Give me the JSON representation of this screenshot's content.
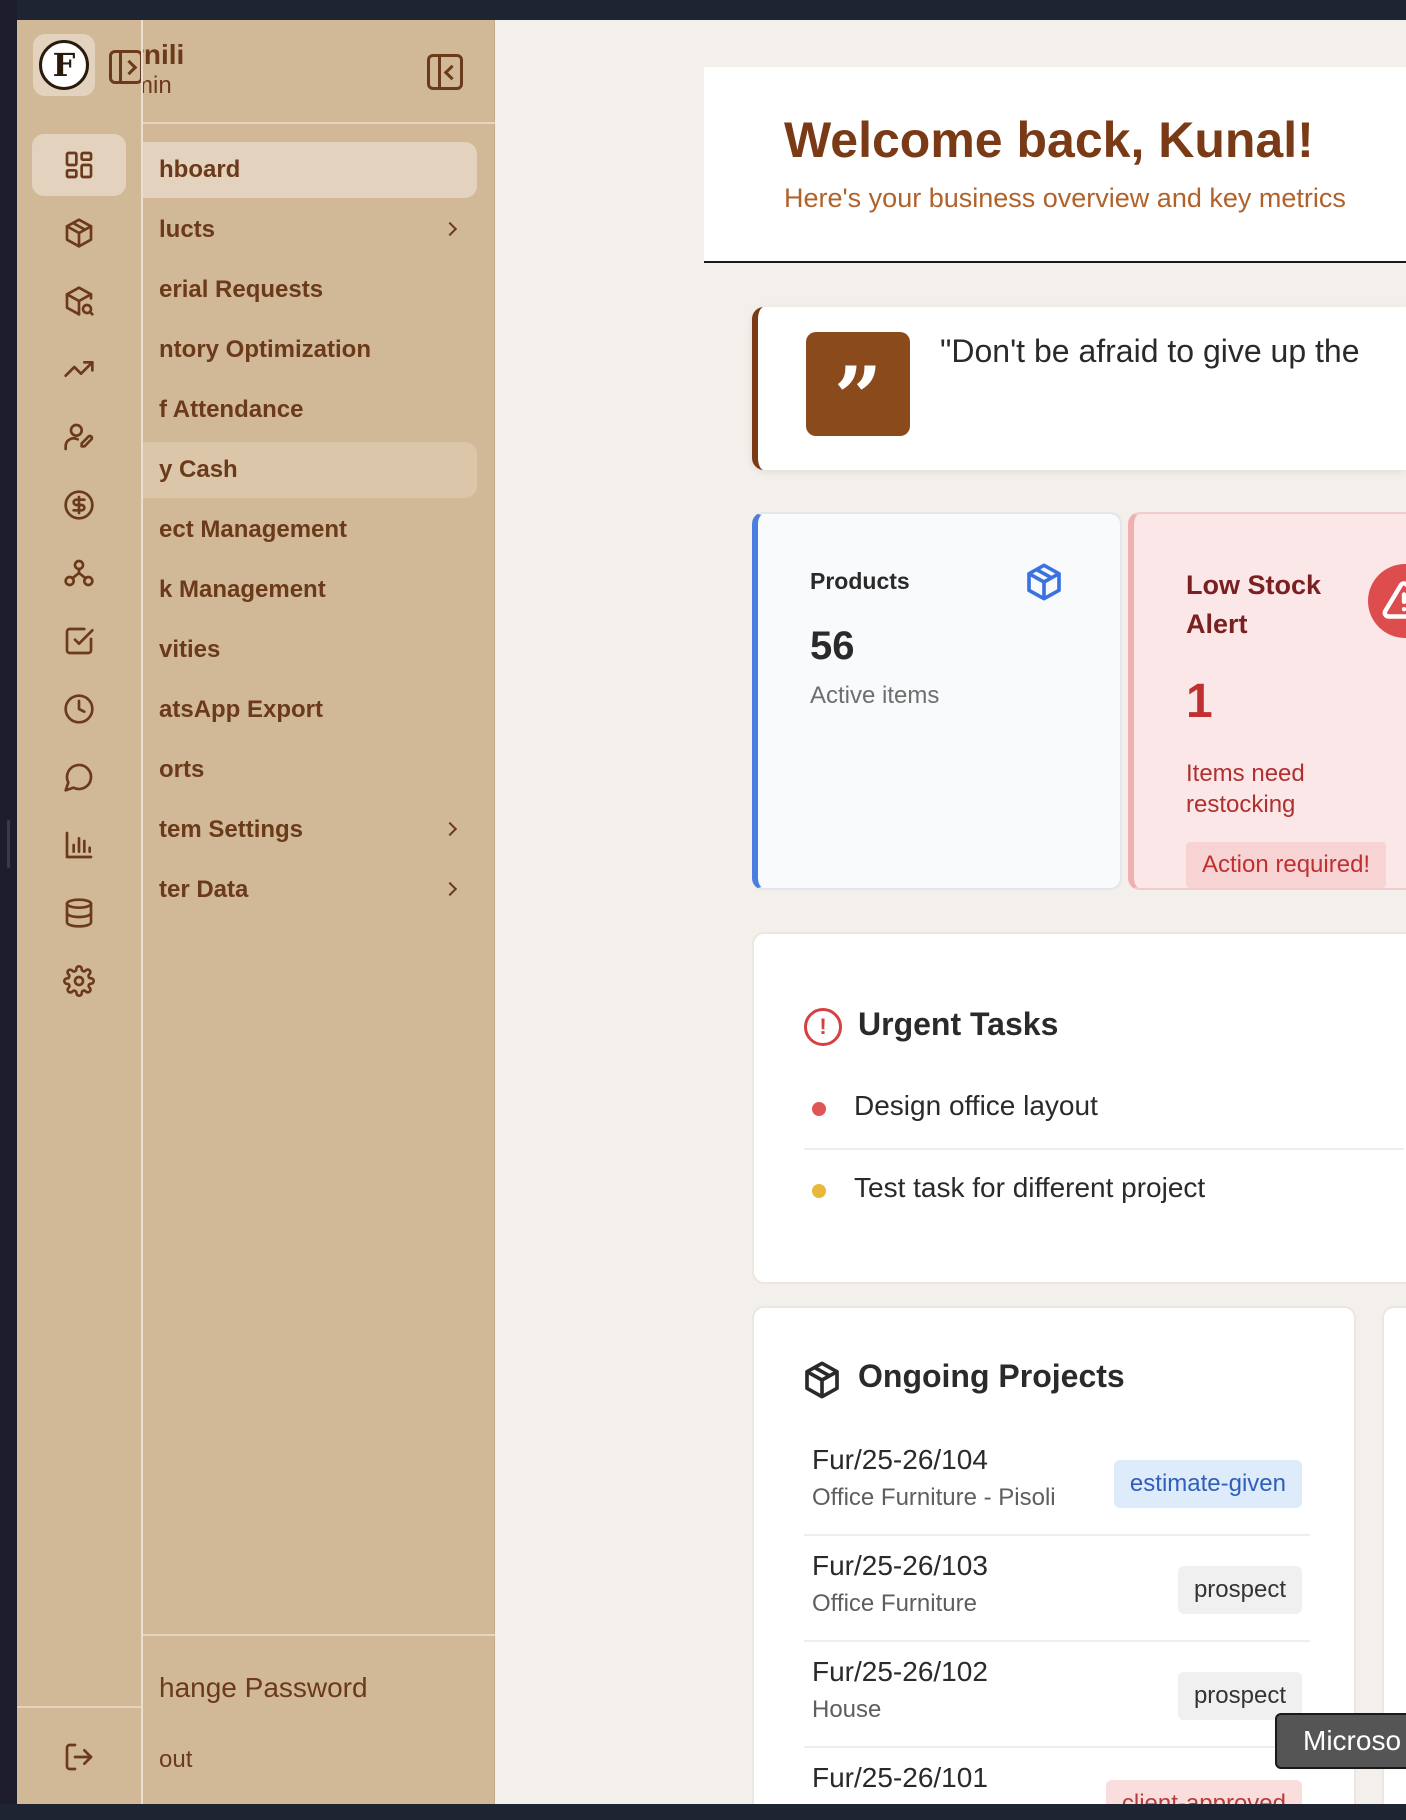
{
  "sidebar": {
    "brand_name": "rnili",
    "brand_role": "min",
    "logo_letter": "F",
    "items": [
      {
        "label": "hboard",
        "icon": "dashboard-icon",
        "active": true
      },
      {
        "label": "lucts",
        "icon": "package-icon",
        "has_submenu": true
      },
      {
        "label": "erial Requests",
        "icon": "package-search-icon"
      },
      {
        "label": "ntory Optimization",
        "icon": "trending-up-icon"
      },
      {
        "label": "f Attendance",
        "icon": "user-pen-icon"
      },
      {
        "label": "y Cash",
        "icon": "dollar-circle-icon",
        "hover": true
      },
      {
        "label": "ect Management",
        "icon": "network-icon"
      },
      {
        "label": "k Management",
        "icon": "check-square-icon"
      },
      {
        "label": "vities",
        "icon": "clock-icon"
      },
      {
        "label": "atsApp Export",
        "icon": "message-circle-icon"
      },
      {
        "label": "orts",
        "icon": "bar-chart-icon"
      },
      {
        "label": "tem Settings",
        "icon": "database-icon",
        "has_submenu": true
      },
      {
        "label": "ter Data",
        "icon": "settings-icon",
        "has_submenu": true
      }
    ],
    "footer": {
      "change_password": "hange Password",
      "logout": "out",
      "logout_icon": "log-out-icon"
    }
  },
  "header": {
    "welcome": "Welcome back, Kunal!",
    "subtitle": "Here's your business overview and key metrics"
  },
  "quote": {
    "text": "\"Don't be afraid to give up the",
    "icon": "quote-icon"
  },
  "stats": {
    "products": {
      "label": "Products",
      "value": "56",
      "sub": "Active items",
      "icon": "package-icon",
      "accent": "#4a7fe0"
    },
    "low_stock": {
      "label": "Low Stock Alert",
      "value": "1",
      "sub": "Items need restocking",
      "badge": "Action required!",
      "icon": "alert-triangle-icon",
      "accent": "#dd4d4d"
    }
  },
  "urgent_tasks": {
    "title": "Urgent Tasks",
    "items": [
      {
        "text": "Design office layout",
        "dot_color": "#e05555"
      },
      {
        "text": "Test task for different project",
        "dot_color": "#e8b83a"
      }
    ]
  },
  "ongoing_projects": {
    "title": "Ongoing Projects",
    "items": [
      {
        "code": "Fur/25-26/104",
        "name": "Office Furniture - Pisoli",
        "status": "estimate-given",
        "tone": "blue"
      },
      {
        "code": "Fur/25-26/103",
        "name": "Office Furniture",
        "status": "prospect",
        "tone": "gray"
      },
      {
        "code": "Fur/25-26/102",
        "name": "House",
        "status": "prospect",
        "tone": "gray"
      },
      {
        "code": "Fur/25-26/101",
        "name": "",
        "status": "client-approved",
        "tone": "red"
      }
    ]
  },
  "toast": {
    "text": "Microso"
  },
  "colors": {
    "sidebar_bg": "#d1b998",
    "brand_brown": "#7a3a16",
    "page_bg": "#f3efea"
  }
}
